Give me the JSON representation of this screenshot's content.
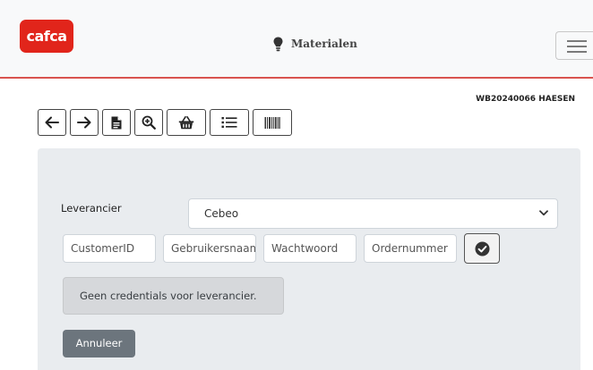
{
  "brand": {
    "logo_text": "cafca",
    "color": "#e1251b"
  },
  "nav": {
    "title": "Materialen",
    "icon": "lightbulb-icon",
    "menu_icon": "hamburger-icon"
  },
  "document_ref": "WB20240066 HAESEN",
  "toolbar": {
    "buttons": [
      {
        "icon": "arrow-left-icon"
      },
      {
        "icon": "arrow-right-icon"
      },
      {
        "icon": "document-icon"
      },
      {
        "icon": "zoom-in-icon"
      },
      {
        "icon": "basket-icon"
      },
      {
        "icon": "list-icon"
      },
      {
        "icon": "barcode-icon"
      }
    ]
  },
  "form": {
    "supplier_label": "Leverancier",
    "supplier_value": "Cebeo",
    "fields": {
      "customer_id": "CustomerID",
      "username": "Gebruikersnaam",
      "password": "Wachtwoord",
      "order_number": "Ordernummer"
    },
    "confirm_icon": "check-circle-icon"
  },
  "message": "Geen credentials voor leverancier.",
  "cancel_label": "Annuleer",
  "colors": {
    "accent_line": "#d9534f",
    "panel": "#e9ecef",
    "secondary_button": "#6c757d"
  }
}
